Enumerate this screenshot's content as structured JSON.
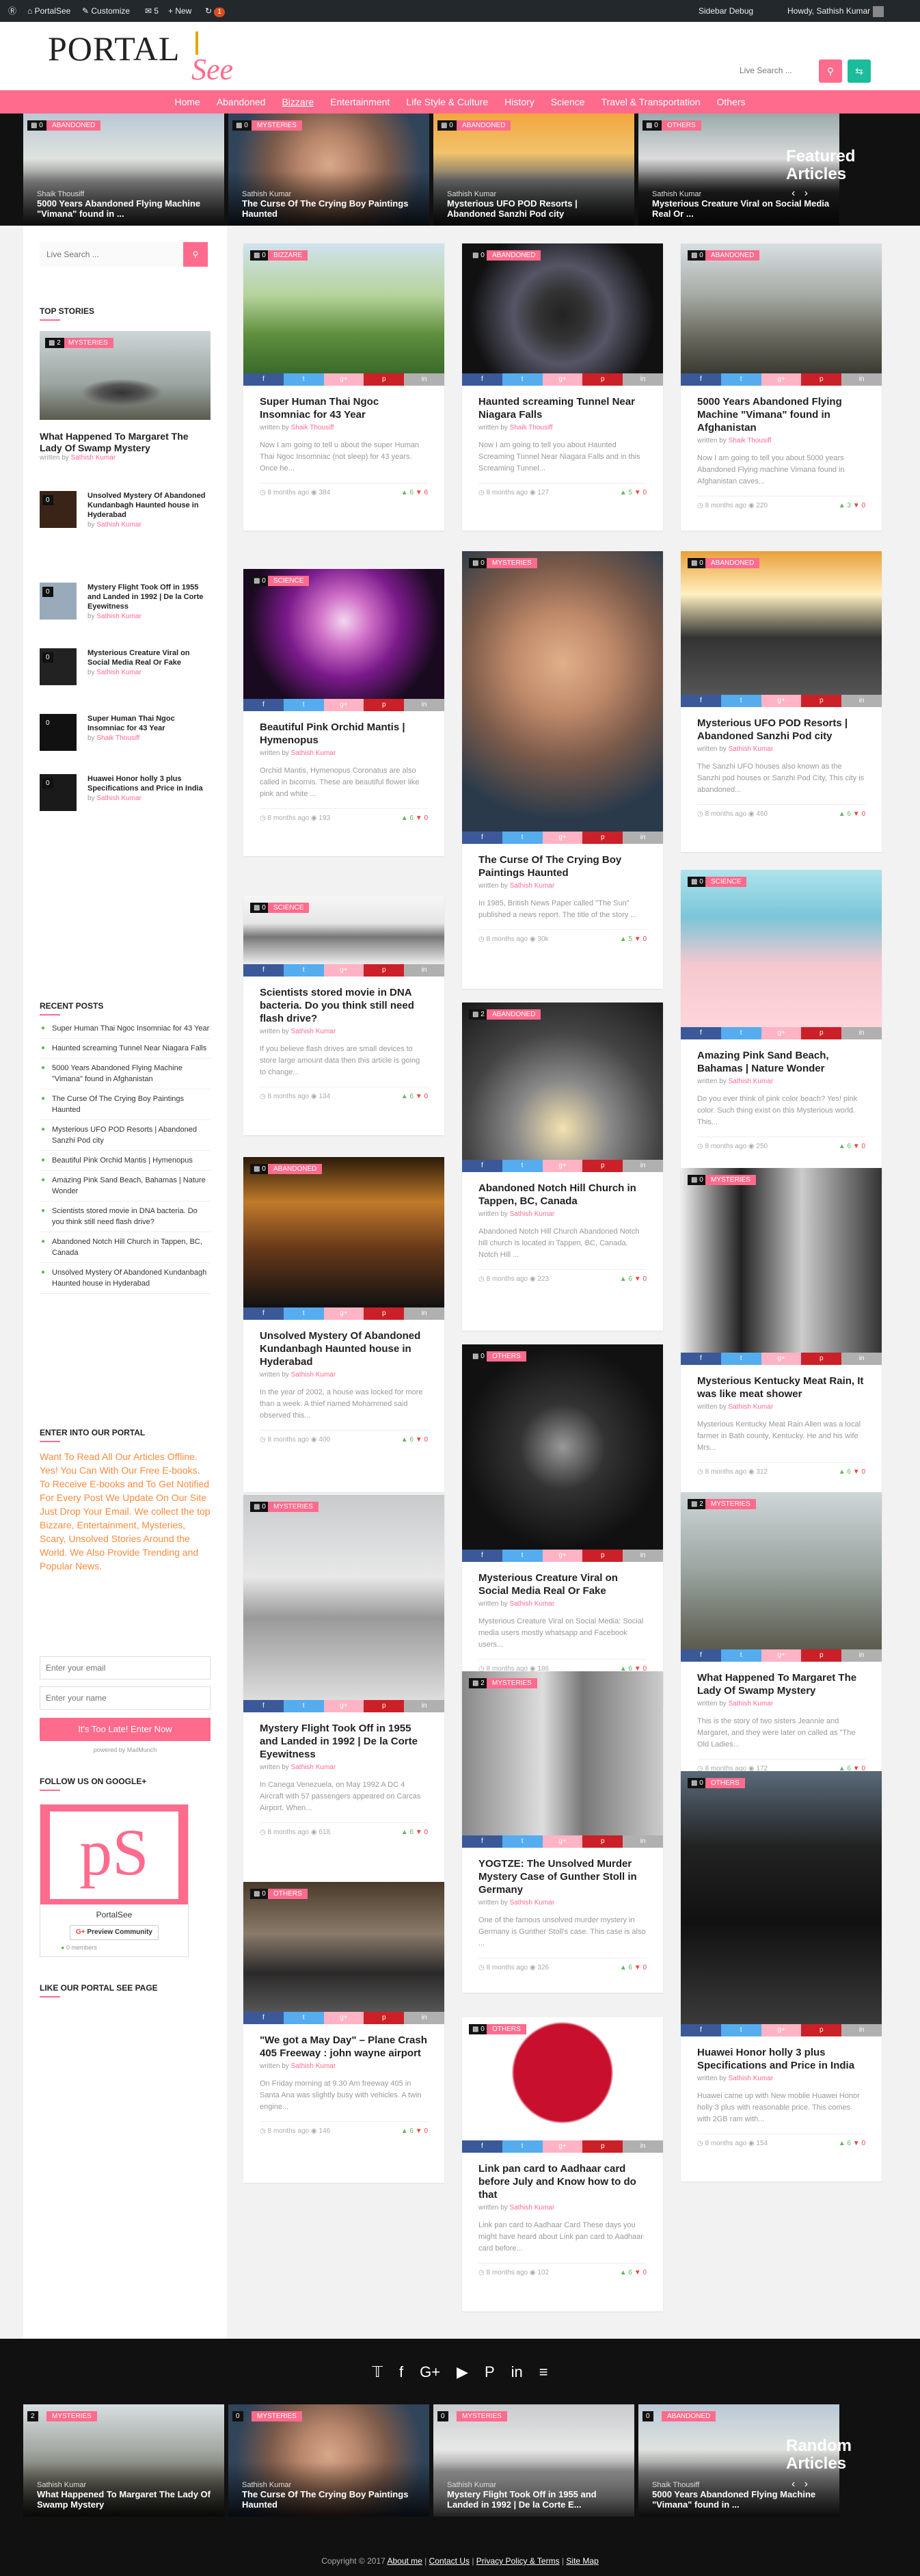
{
  "adminbar": {
    "site": "PortalSee",
    "customize": "Customize",
    "comments": "5",
    "new": "+ New",
    "updates": "1",
    "debug": "Sidebar Debug",
    "howdy": "Howdy, Sathish Kumar"
  },
  "header": {
    "logo_1": "PORTAL",
    "logo_2": "See",
    "search_placeholder": "Live Search ..."
  },
  "nav": [
    "Home",
    "Abandoned",
    "Bizzare",
    "Entertainment",
    "Life Style & Culture",
    "History",
    "Science",
    "Travel & Transportation",
    "Others"
  ],
  "featured": {
    "title_1": "Featured",
    "title_2": "Articles",
    "items": [
      {
        "cat": "Abandoned",
        "count": "0",
        "author": "Shaik Thousiff",
        "title": "5000 Years Abandoned Flying Machine \"Vimana\" found in ..."
      },
      {
        "cat": "Mysteries",
        "count": "0",
        "author": "Sathish Kumar",
        "title": "The Curse Of The Crying Boy Paintings Haunted"
      },
      {
        "cat": "Abandoned",
        "count": "0",
        "author": "Sathish Kumar",
        "title": "Mysterious UFO POD Resorts | Abandoned Sanzhi Pod city"
      },
      {
        "cat": "Others",
        "count": "0",
        "author": "Sathish Kumar",
        "title": "Mysterious Creature Viral on Social Media Real Or ..."
      }
    ]
  },
  "sidebar": {
    "search_placeholder": "Live Search ...",
    "top_stories_heading": "Top Stories",
    "top_main": {
      "cat": "Mysteries",
      "count": "2",
      "title": "What Happened To Margaret The Lady Of Swamp Mystery",
      "author": "Sathish Kumar"
    },
    "top_list": [
      {
        "count": "0",
        "title": "Unsolved Mystery Of Abandoned Kundanbagh Haunted house in Hyderabad",
        "author": "Sathish Kumar"
      },
      {
        "count": "0",
        "title": "Mystery Flight Took Off in 1955 and Landed in 1992 | De la Corte Eyewitness",
        "author": "Sathish Kumar"
      },
      {
        "count": "0",
        "title": "Mysterious Creature Viral on Social Media Real Or Fake",
        "author": "Sathish Kumar"
      },
      {
        "count": "0",
        "title": "Super Human Thai Ngoc Insomniac for 43 Year",
        "author": "Shaik Thousiff"
      },
      {
        "count": "0",
        "title": "Huawei Honor holly 3 plus Specifications and Price in India",
        "author": "Sathish Kumar"
      }
    ],
    "recent_heading": "Recent Posts",
    "recent": [
      "Super Human Thai Ngoc Insomniac for 43 Year",
      "Haunted screaming Tunnel Near Niagara Falls",
      "5000 Years Abandoned Flying Machine \"Vimana\" found in Afghanistan",
      "The Curse Of The Crying Boy Paintings Haunted",
      "Mysterious UFO POD Resorts | Abandoned Sanzhi Pod city",
      "Beautiful Pink Orchid Mantis | Hymenopus",
      "Amazing Pink Sand Beach, Bahamas | Nature Wonder",
      "Scientists stored movie in DNA bacteria. Do you think still need flash drive?",
      "Abandoned Notch Hill Church in Tappen, BC, Canada",
      "Unsolved Mystery Of Abandoned Kundanbagh Haunted house in Hyderabad"
    ],
    "enter_heading": "Enter into our Portal",
    "enter_text": "Want To Read All Our Articles Offline. Yes! You Can With Our Free E-books. To Receive E-books and To Get Notified For Every Post We Update On Our Site Just Drop Your Email. We collect the top Bizzare, Entertainment, Mysteries, Scary, Unsolved Stories Around the World. We Also Provide Trending and Popular News.",
    "email_placeholder": "Enter your email",
    "name_placeholder": "Enter your name",
    "submit": "It's Too Late! Enter Now",
    "powered": "powered by MailMunch",
    "google_heading": "Follow us on Google+",
    "gplus_name": "PortalSee",
    "gplus_btn": "Preview Community",
    "gplus_members": "0 members",
    "like_heading": "Like our Portal see page"
  },
  "cards": [
    {
      "cat": "Bizzare",
      "count": "0",
      "title": "Super Human Thai Ngoc Insomniac for 43 Year",
      "author": "Shaik Thousiff",
      "excerpt": "Now I am going to tell u about the super Human Thai Ngoc Insomniac (not sleep) for 43 years. Once he...",
      "time": "8 months ago",
      "views": "384",
      "up": "6",
      "down": "6"
    },
    {
      "cat": "Science",
      "count": "0",
      "title": "Beautiful Pink Orchid Mantis | Hymenopus",
      "author": "Sathish Kumar",
      "excerpt": "Orchid Mantis, Hymenopus Coronatus are also called in bicornis. These are beautiful flower like pink and white ...",
      "time": "8 months ago",
      "views": "193",
      "up": "6",
      "down": "0"
    },
    {
      "cat": "Science",
      "count": "0",
      "title": "Scientists stored movie in DNA bacteria. Do you think still need flash drive?",
      "author": "Sathish Kumar",
      "excerpt": "If you believe flash drives are small devices to store large amount data then this article is going to change...",
      "time": "8 months ago",
      "views": "134",
      "up": "6",
      "down": "0"
    },
    {
      "cat": "Abandoned",
      "count": "0",
      "title": "Unsolved Mystery Of Abandoned Kundanbagh Haunted house in Hyderabad",
      "author": "Sathish Kumar",
      "excerpt": "In the year of 2002, a house was locked for more than a week. A thief named Mohammed said observed this...",
      "time": "8 months ago",
      "views": "400",
      "up": "6",
      "down": "0"
    },
    {
      "cat": "Mysteries",
      "count": "0",
      "title": "Mystery Flight Took Off in 1955 and Landed in 1992 | De la Corte Eyewitness",
      "author": "Sathish Kumar",
      "excerpt": "In Canega Venezuela, on May 1992 A DC 4 Aircraft with 57 passengers appeared on Carcas Airport. When...",
      "time": "8 months ago",
      "views": "618",
      "up": "6",
      "down": "0"
    },
    {
      "cat": "Others",
      "count": "0",
      "title": "\"We got a May Day\" – Plane Crash 405 Freeway : john wayne airport",
      "author": "Sathish Kumar",
      "excerpt": "On Friday morning at 9.30 Am freeway 405 in Santa Ana was slightly busy with vehicles. A twin engine...",
      "time": "8 months ago",
      "views": "146",
      "up": "6",
      "down": "0"
    },
    {
      "cat": "Abandoned",
      "count": "0",
      "title": "Haunted screaming Tunnel Near Niagara Falls",
      "author": "Shaik Thousiff",
      "excerpt": "Now I am going to tell you about Haunted Screaming Tunnel Near Niagara Falls and in this Screaming Tunnel...",
      "time": "8 months ago",
      "views": "127",
      "up": "5",
      "down": "0"
    },
    {
      "cat": "Mysteries",
      "count": "0",
      "title": "The Curse Of The Crying Boy Paintings Haunted",
      "author": "Sathish Kumar",
      "excerpt": "In 1985, British News Paper called \"The Sun\" published a news report. The title of the story ...",
      "time": "8 months ago",
      "views": "30k",
      "up": "5",
      "down": "0"
    },
    {
      "cat": "Abandoned",
      "count": "2",
      "title": "Abandoned Notch Hill Church in Tappen, BC, Canada",
      "author": "Sathish Kumar",
      "excerpt": "Abandoned Notch Hill Church Abandoned Notch hill church is located in Tappen, BC, Canada. Notch Hill ...",
      "time": "8 months ago",
      "views": "223",
      "up": "6",
      "down": "0"
    },
    {
      "cat": "Others",
      "count": "0",
      "title": "Mysterious Creature Viral on Social Media Real Or Fake",
      "author": "Sathish Kumar",
      "excerpt": "Mysterious Creature Viral on Social Media: Social media users mostly whatsapp and Facebook users...",
      "time": "8 months ago",
      "views": "186",
      "up": "6",
      "down": "0"
    },
    {
      "cat": "Mysteries",
      "count": "2",
      "title": "YOGTZE: The Unsolved Murder Mystery Case of Gunther Stoll in Germany",
      "author": "Sathish Kumar",
      "excerpt": "One of the famous unsolved murder mystery in Germany is Gunther Stoll's case. This case is also ...",
      "time": "8 months ago",
      "views": "326",
      "up": "6",
      "down": "0"
    },
    {
      "cat": "Others",
      "count": "0",
      "title": "Link pan card to Aadhaar card before July and Know how to do that",
      "author": "Sathish Kumar",
      "excerpt": "Link pan card to Aadhaar Card These days you might have heard about Link pan card to Aadhaar card before...",
      "time": "8 months ago",
      "views": "102",
      "up": "6",
      "down": "0"
    },
    {
      "cat": "Abandoned",
      "count": "0",
      "title": "5000 Years Abandoned Flying Machine \"Vimana\" found in Afghanistan",
      "author": "Shaik Thousiff",
      "excerpt": "Now I am going to tell you about 5000 years Abandoned Flying machine Vimana found in Afghanistan caves...",
      "time": "8 months ago",
      "views": "220",
      "up": "3",
      "down": "0"
    },
    {
      "cat": "Abandoned",
      "count": "0",
      "title": "Mysterious UFO POD Resorts | Abandoned Sanzhi Pod city",
      "author": "Sathish Kumar",
      "excerpt": "The Sanzhi UFO houses also known as the Sanzhi pod houses or Sanzhi Pod City, This city is abandoned...",
      "time": "8 months ago",
      "views": "460",
      "up": "6",
      "down": "0"
    },
    {
      "cat": "Science",
      "count": "0",
      "title": "Amazing Pink Sand Beach, Bahamas | Nature Wonder",
      "author": "Sathish Kumar",
      "excerpt": "Do you ever think of pink color beach? Yes! pink color. Such thing exist on this Mysterious world. This...",
      "time": "8 months ago",
      "views": "250",
      "up": "6",
      "down": "0"
    },
    {
      "cat": "Mysteries",
      "count": "0",
      "title": "Mysterious Kentucky Meat Rain, It was like meat shower",
      "author": "Sathish Kumar",
      "excerpt": "Mysterious Kentucky Meat Rain Allen was a local farmer in Bath county, Kentucky. He and his wife Mrs...",
      "time": "8 months ago",
      "views": "312",
      "up": "6",
      "down": "0"
    },
    {
      "cat": "Mysteries",
      "count": "2",
      "title": "What Happened To Margaret The Lady Of Swamp Mystery",
      "author": "Sathish Kumar",
      "excerpt": "This is the story of two sisters Jeannie and Margaret, and they were later on called as \"The Old Ladies...",
      "time": "8 months ago",
      "views": "172",
      "up": "6",
      "down": "0"
    },
    {
      "cat": "Others",
      "count": "0",
      "title": "Huawei Honor holly 3 plus Specifications and Price in India",
      "author": "Sathish Kumar",
      "excerpt": "Huawei came up with New mobile Huawei Honor holly 3 plus with reasonable price. This comes with 2GB ram with...",
      "time": "8 months ago",
      "views": "154",
      "up": "6",
      "down": "0"
    }
  ],
  "share": [
    "f",
    "t",
    "g+",
    "p",
    "in"
  ],
  "footer": {
    "icons": [
      "twitter-icon",
      "facebook-icon",
      "google-plus-icon",
      "youtube-icon",
      "pinterest-icon",
      "linkedin-icon",
      "rss-icon"
    ],
    "random_1": "Random",
    "random_2": "Articles",
    "random": [
      {
        "cat": "Mysteries",
        "count": "2",
        "author": "Sathish Kumar",
        "title": "What Happened To Margaret The Lady Of Swamp Mystery"
      },
      {
        "cat": "Mysteries",
        "count": "0",
        "author": "Sathish Kumar",
        "title": "The Curse Of The Crying Boy Paintings Haunted"
      },
      {
        "cat": "Mysteries",
        "count": "0",
        "author": "Sathish Kumar",
        "title": "Mystery Flight Took Off in 1955 and Landed in 1992 | De la Corte E..."
      },
      {
        "cat": "Abandoned",
        "count": "0",
        "author": "Shaik Thousiff",
        "title": "5000 Years Abandoned Flying Machine \"Vimana\" found in ..."
      }
    ],
    "copyright": "Copyright © 2017",
    "links": [
      "About me",
      "Contact Us",
      "Privacy Policy & Terms",
      "Site Map"
    ]
  },
  "colors": {
    "accent": "#ff6b8d",
    "dark": "#111111",
    "green": "#5fb85f"
  }
}
